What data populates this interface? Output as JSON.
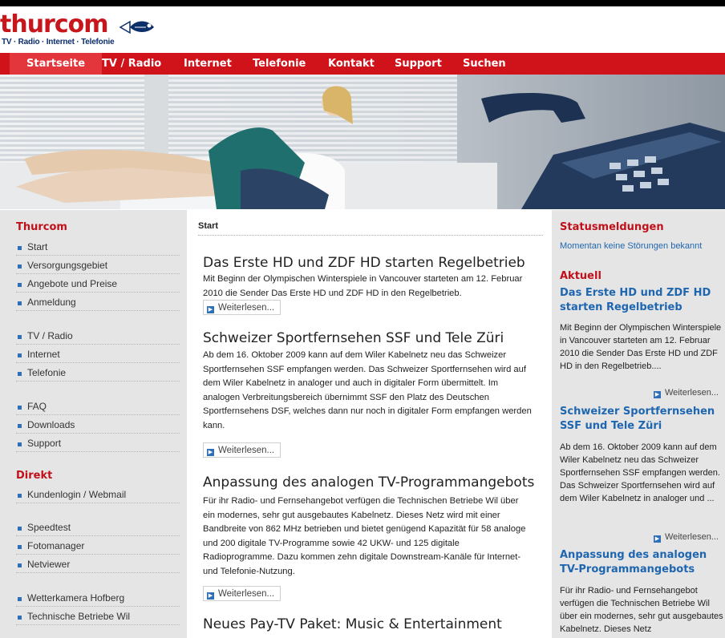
{
  "brand": {
    "logo_text": "thurcom",
    "tagline": "TV · Radio · Internet · Telefonie"
  },
  "nav": [
    "Startseite",
    "TV / Radio",
    "Internet",
    "Telefonie",
    "Kontakt",
    "Support",
    "Suchen"
  ],
  "sidebar": {
    "thurcom_title": "Thurcom",
    "thurcom_items": [
      "Start",
      "Versorgungsgebiet",
      "Angebote und Preise",
      "Anmeldung",
      "TV / Radio",
      "Internet",
      "Telefonie",
      "FAQ",
      "Downloads",
      "Support"
    ],
    "direkt_title": "Direkt",
    "direkt_items": [
      "Kundenlogin / Webmail",
      "Speedtest",
      "Fotomanager",
      "Netviewer",
      "Wetterkamera Hofberg",
      "Technische Betriebe Wil"
    ]
  },
  "main": {
    "breadcrumb": "Start",
    "more_label": "Weiterlesen...",
    "articles": [
      {
        "title": "Das Erste HD und ZDF HD starten Regelbetrieb",
        "body": "Mit Beginn der Olympischen Winterspiele in Vancouver starteten am 12. Februar 2010 die Sender Das Erste HD und ZDF HD in den Regelbetrieb."
      },
      {
        "title": "Schweizer Sportfernsehen SSF und Tele Züri",
        "body": "Ab dem 16. Oktober 2009 kann auf dem Wiler Kabelnetz neu das Schweizer Sportfernsehen SSF empfangen werden. Das Schweizer Sportfernsehen wird auf dem Wiler Kabelnetz in analoger und auch in digitaler Form übermittelt. Im analogen Verbreitungsbereich übernimmt SSF den Platz des Deutschen Sportfernsehens DSF, welches dann nur noch in digitaler Form empfangen werden kann."
      },
      {
        "title": "Anpassung des analogen TV-Programmangebots",
        "body": "Für ihr Radio- und Fernsehangebot verfügen die Technischen Betriebe Wil über ein modernes, sehr gut ausgebautes Kabelnetz. Dieses Netz wird mit einer Bandbreite von 862 MHz betrieben und bietet genügend Kapazität für 58 analoge und 200 digitale TV-Programme sowie 42 UKW- und 125 digitale Radioprogramme. Dazu kommen zehn digitale Downstream-Kanäle für Internet- und Telefonie-Nutzung."
      },
      {
        "title": "Neues Pay-TV Paket: Music & Entertainment",
        "body": ""
      }
    ]
  },
  "right": {
    "status_title": "Statusmeldungen",
    "status_text": "Momentan keine Störungen bekannt",
    "aktuell_title": "Aktuell",
    "more_label": "Weiterlesen...",
    "news": [
      {
        "title": "Das Erste HD und ZDF HD starten Regelbetrieb",
        "body": "Mit Beginn der Olympischen Winterspiele in Vancouver starteten am 12. Februar 2010 die Sender Das Erste HD und ZDF HD in den Regelbetrieb...."
      },
      {
        "title": "Schweizer Sportfernsehen SSF und Tele Züri",
        "body": "Ab dem 16. Oktober 2009 kann auf dem Wiler Kabelnetz neu das Schweizer Sportfernsehen SSF empfangen werden. Das Schweizer Sportfernsehen wird auf dem Wiler Kabelnetz in analoger und ..."
      },
      {
        "title": "Anpassung des analogen TV-Programmangebots",
        "body": "Für ihr Radio- und Fernsehangebot verfügen die Technischen Betriebe Wil über ein modernes, sehr gut ausgebautes Kabelnetz. Dieses Netz"
      }
    ]
  },
  "colors": {
    "brand_red": "#d0121a",
    "link_blue": "#1f66b0",
    "side_bg": "#e5e5e5"
  },
  "icons": [
    "fish-logo-icon",
    "arrow-right-icon",
    "square-bullet-icon"
  ]
}
